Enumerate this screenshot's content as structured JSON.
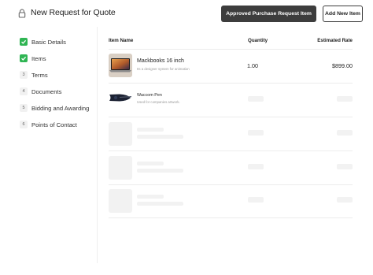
{
  "header": {
    "title": "New Request for Quote",
    "approve_label": "Approved Purchase Request Item",
    "add_label": "Add New Item"
  },
  "steps": [
    {
      "label": "Basic Details",
      "state": "done",
      "marker": ""
    },
    {
      "label": "Items",
      "state": "done",
      "marker": ""
    },
    {
      "label": "Terms",
      "state": "pending",
      "marker": "3"
    },
    {
      "label": "Documents",
      "state": "pending",
      "marker": "4"
    },
    {
      "label": "Bidding and Awarding",
      "state": "pending",
      "marker": "5"
    },
    {
      "label": "Points of Contact",
      "state": "pending",
      "marker": "6"
    }
  ],
  "table": {
    "columns": {
      "item": "Item Name",
      "quantity": "Quantity",
      "rate": "Estimated Rate"
    },
    "rows": [
      {
        "name": "Mackbooks 16 inch",
        "description": "Its a designer system for animation",
        "quantity": "1.00",
        "rate": "$899.00",
        "icon": "laptop-thumbnail"
      },
      {
        "name": "Waccom Pen",
        "description": "Used for companies artwork.",
        "quantity": "",
        "rate": "",
        "icon": "pen-tablet-thumbnail"
      }
    ]
  },
  "colors": {
    "check": "#2fb553",
    "primary_button": "#3d3d3d"
  }
}
